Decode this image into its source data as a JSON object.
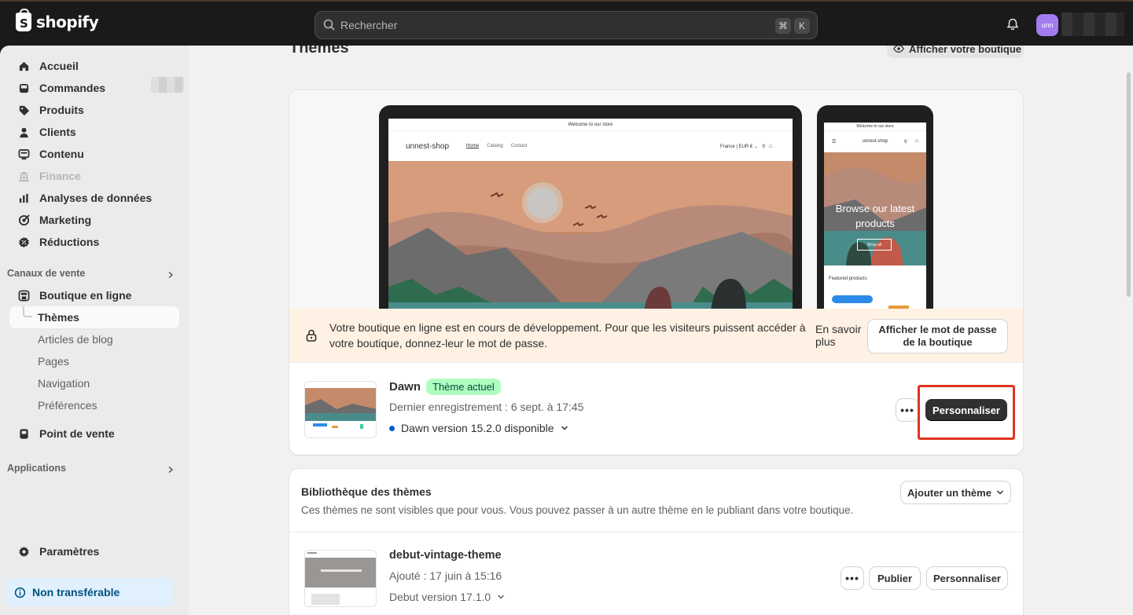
{
  "topbar": {
    "logo_text": "shopify",
    "logo_letter": "S",
    "search_placeholder": "Rechercher",
    "shortcut_cmd": "⌘",
    "shortcut_key": "K",
    "avatar_initials": "unn"
  },
  "sidebar": {
    "items": [
      {
        "label": "Accueil",
        "icon": "home-icon"
      },
      {
        "label": "Commandes",
        "icon": "inbox-icon"
      },
      {
        "label": "Produits",
        "icon": "tag-icon"
      },
      {
        "label": "Clients",
        "icon": "person-icon"
      },
      {
        "label": "Contenu",
        "icon": "content-icon"
      },
      {
        "label": "Finance",
        "icon": "bank-icon"
      },
      {
        "label": "Analyses de données",
        "icon": "chart-icon"
      },
      {
        "label": "Marketing",
        "icon": "target-icon"
      },
      {
        "label": "Réductions",
        "icon": "discount-icon"
      }
    ],
    "sales_channels_label": "Canaux de vente",
    "online_store_label": "Boutique en ligne",
    "themes_label": "Thèmes",
    "sub_items": [
      "Articles de blog",
      "Pages",
      "Navigation",
      "Préférences"
    ],
    "pos_label": "Point de vente",
    "apps_label": "Applications",
    "settings_label": "Paramètres",
    "non_transferable_label": "Non transférable"
  },
  "main": {
    "page_title": "Thèmes",
    "view_store_label": "Afficher votre boutique",
    "preview": {
      "announcement": "Welcome to our store",
      "store_name": "unnest-shop",
      "nav_links": [
        "Home",
        "Catalog",
        "Contact"
      ],
      "locale": "France | EUR € ⌄",
      "phone_hero_text": "Browse our latest products",
      "shop_all": "Shop all",
      "featured": "Featured products"
    },
    "dev_banner": {
      "text": "Votre boutique en ligne est en cours de développement. Pour que les visiteurs puissent accéder à votre boutique, donnez-leur le mot de passe.",
      "learn_more": "En savoir plus",
      "password_button": "Afficher le mot de passe de la boutique"
    },
    "current_theme": {
      "name": "Dawn",
      "badge": "Thème actuel",
      "last_saved": "Dernier enregistrement : 6 sept. à 17:45",
      "version": "Dawn version 15.2.0 disponible",
      "customize_label": "Personnaliser",
      "more_label": "•••"
    },
    "library": {
      "title": "Bibliothèque des thèmes",
      "description": "Ces thèmes ne sont visibles que pour vous. Vous pouvez passer à un autre thème en le publiant dans votre boutique.",
      "add_theme_label": "Ajouter un thème",
      "themes": [
        {
          "name": "debut-vintage-theme",
          "added": "Ajouté : 17 juin à 15:16",
          "version": "Debut version 17.1.0",
          "publish_label": "Publier",
          "customize_label": "Personnaliser",
          "more_label": "•••"
        }
      ]
    }
  },
  "colors": {
    "topbar": "#1a1a1a",
    "sidebar": "#ebebeb",
    "main_bg": "#f1f1f1",
    "badge_green": "#affebf",
    "highlight_red": "#e0341f",
    "primary_button": "#303030",
    "banner_bg": "#fff1e3"
  }
}
